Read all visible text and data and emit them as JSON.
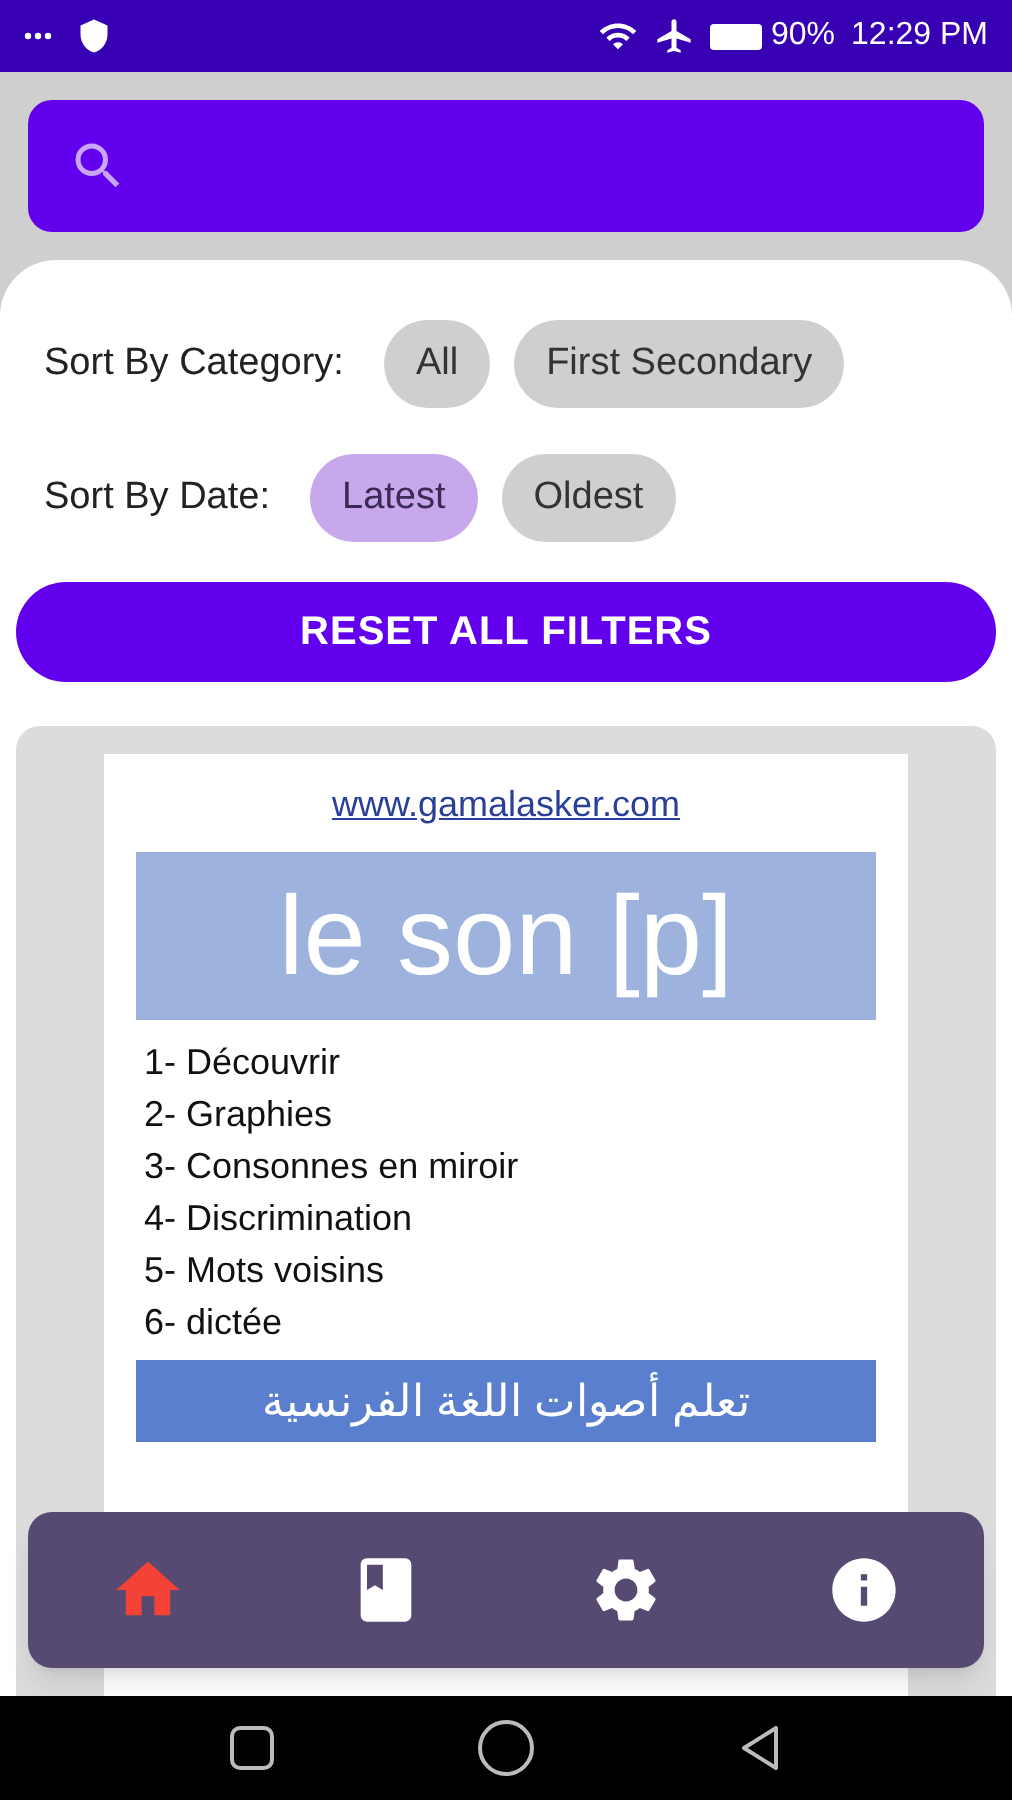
{
  "status_bar": {
    "battery": "90%",
    "time": "12:29 PM"
  },
  "filters": {
    "category": {
      "label": "Sort By Category:",
      "chips": [
        {
          "label": "All",
          "selected": false
        },
        {
          "label": "First Secondary",
          "selected": false
        }
      ]
    },
    "date": {
      "label": "Sort By Date:",
      "chips": [
        {
          "label": "Latest",
          "selected": true
        },
        {
          "label": "Oldest",
          "selected": false
        }
      ]
    },
    "reset_button": "RESET ALL FILTERS"
  },
  "document": {
    "link": "www.gamalasker.com",
    "title": "le son [p]",
    "items": [
      "1- Découvrir",
      "2- Graphies",
      "3- Consonnes en miroir",
      "4- Discrimination",
      "5- Mots voisins",
      "6- dictée"
    ],
    "banner": "تعلم أصوات اللغة الفرنسية"
  },
  "bottom_nav": [
    {
      "kind": "home",
      "selected": true
    },
    {
      "kind": "book",
      "selected": false
    },
    {
      "kind": "settings",
      "selected": false
    },
    {
      "kind": "info",
      "selected": false
    }
  ]
}
